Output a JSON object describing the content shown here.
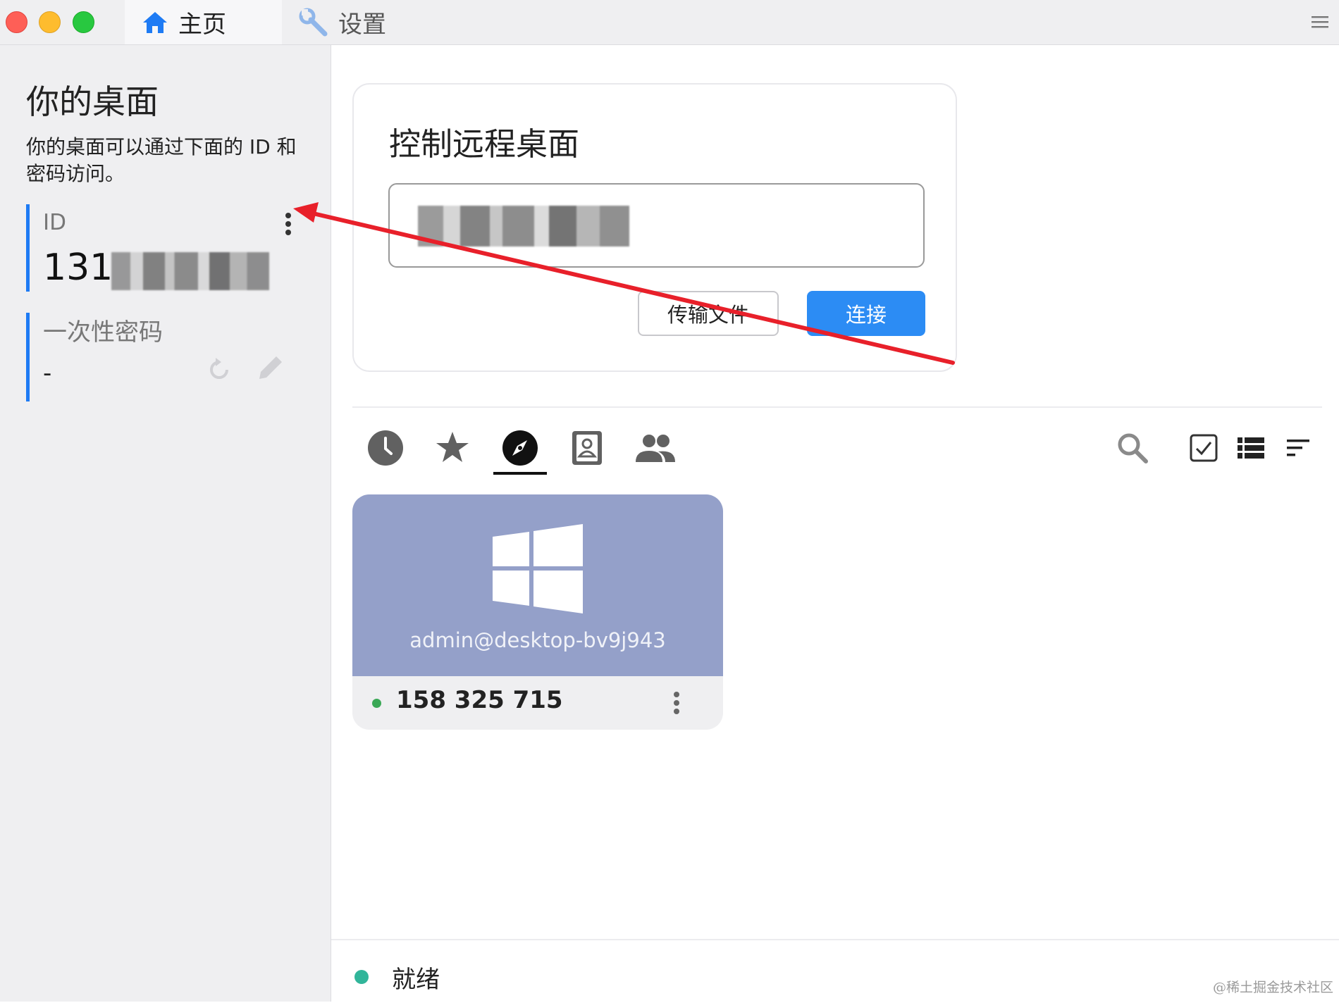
{
  "titlebar": {
    "tabs": [
      {
        "label": "主页",
        "icon": "home-icon"
      },
      {
        "label": "设置",
        "icon": "wrench-icon"
      }
    ],
    "menu_icon": "hamburger-menu-icon"
  },
  "left_panel": {
    "title": "你的桌面",
    "description": "你的桌面可以通过下面的 ID 和密码访问。",
    "id_label": "ID",
    "id_value_prefix": "131",
    "password_label": "一次性密码",
    "password_value": "-"
  },
  "connect_card": {
    "title": "控制远程桌面",
    "transfer_button": "传输文件",
    "connect_button": "连接"
  },
  "peer_tabs": [
    {
      "name": "recent",
      "icon": "clock-icon"
    },
    {
      "name": "favorites",
      "icon": "star-icon"
    },
    {
      "name": "discovered",
      "icon": "compass-icon",
      "active": true
    },
    {
      "name": "address-book",
      "icon": "address-book-icon"
    },
    {
      "name": "group",
      "icon": "group-icon"
    }
  ],
  "peer": {
    "user": "admin@desktop-bv9j943",
    "id": "158 325 715",
    "online": true,
    "os_icon": "windows-icon"
  },
  "status": {
    "text": "就绪",
    "color": "#31b59a"
  },
  "watermark": "@稀土掘金技术社区",
  "colors": {
    "accent": "#2c8cf4",
    "id_bar": "#1e7bf4",
    "annotation_arrow": "#e8202a",
    "peer_thumb": "#94a0c9"
  }
}
